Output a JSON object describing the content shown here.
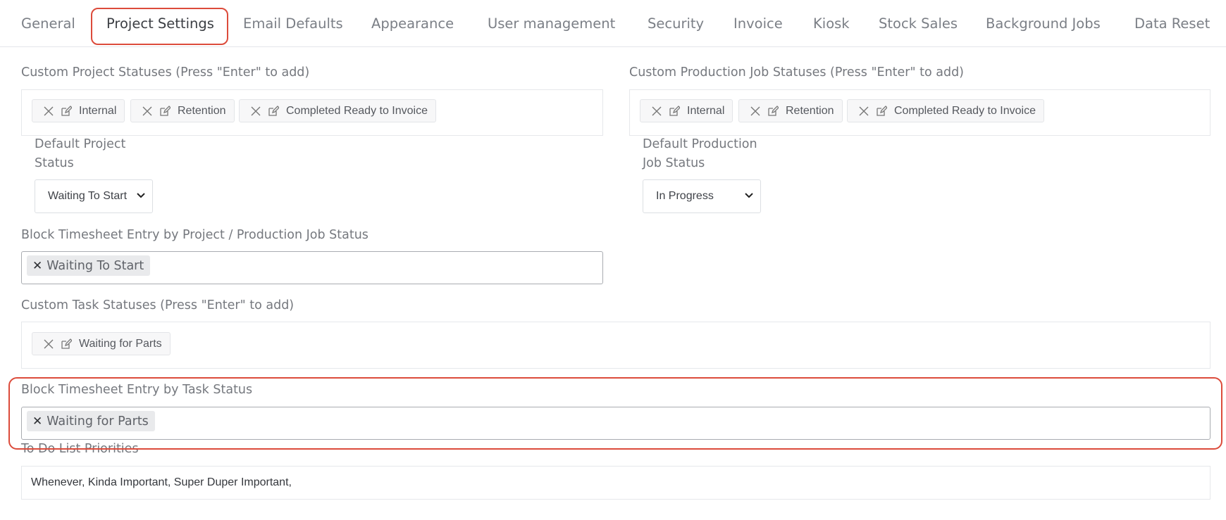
{
  "tabs": [
    {
      "label": "General"
    },
    {
      "label": "Project Settings",
      "active": true
    },
    {
      "label": "Email Defaults"
    },
    {
      "label": "Appearance"
    },
    {
      "label": "User management"
    },
    {
      "label": "Security"
    },
    {
      "label": "Invoice"
    },
    {
      "label": "Kiosk"
    },
    {
      "label": "Stock Sales"
    },
    {
      "label": "Background Jobs"
    },
    {
      "label": "Data Reset"
    }
  ],
  "project_statuses": {
    "label": "Custom Project Statuses (Press \"Enter\" to add)",
    "chips": [
      "Internal",
      "Retention",
      "Completed Ready to Invoice"
    ]
  },
  "production_statuses": {
    "label": "Custom Production Job Statuses (Press \"Enter\" to add)",
    "chips": [
      "Internal",
      "Retention",
      "Completed Ready to Invoice"
    ]
  },
  "default_project_status": {
    "label_line1": "Default Project",
    "label_line2": "Status",
    "value": "Waiting To Start"
  },
  "default_production_status": {
    "label_line1": "Default Production",
    "label_line2": "Job Status",
    "value": "In Progress"
  },
  "block_by_project": {
    "label": "Block Timesheet Entry by Project / Production Job Status",
    "tags": [
      "Waiting To Start"
    ]
  },
  "task_statuses": {
    "label": "Custom Task Statuses (Press \"Enter\" to add)",
    "chips": [
      "Waiting for Parts"
    ]
  },
  "block_by_task": {
    "label": "Block Timesheet Entry by Task Status",
    "tags": [
      "Waiting for Parts"
    ]
  },
  "todo_priorities": {
    "label": "To Do List Priorities",
    "value": "Whenever, Kinda Important, Super Duper Important,"
  },
  "colors": {
    "highlight": "#dc4b3b",
    "active_tab_text": "#3c3f44",
    "tab_text": "#7b7f86"
  }
}
